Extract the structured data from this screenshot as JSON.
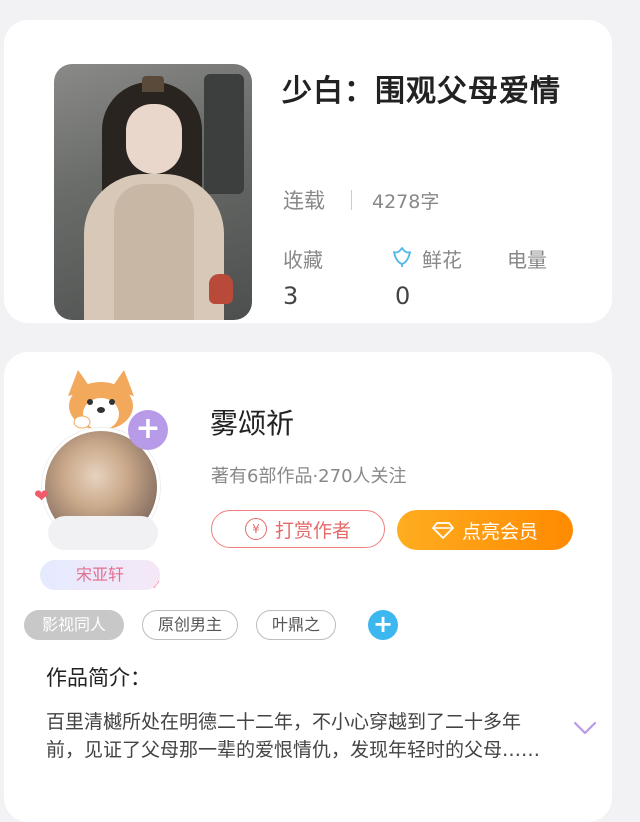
{
  "book": {
    "title": "少白：围观父母爱情",
    "status": "连载",
    "word_count": "4278字",
    "stats": [
      {
        "label": "收藏",
        "value": "3"
      },
      {
        "label": "鲜花",
        "value": "0",
        "icon": "flower-icon"
      },
      {
        "label": "电量",
        "value": ""
      }
    ]
  },
  "author": {
    "name": "雾颂祈",
    "meta": "著有6部作品·270人关注",
    "name_tag": "宋亚轩",
    "tip_button": "打赏作者",
    "vip_button": "点亮会员"
  },
  "tags": [
    {
      "label": "影视同人",
      "style": "filled"
    },
    {
      "label": "原创男主",
      "style": "outline"
    },
    {
      "label": "叶鼎之",
      "style": "outline"
    }
  ],
  "intro": {
    "heading": "作品简介：",
    "text": "百里清樾所处在明德二十二年，不小心穿越到了二十多年前，见证了父母那一辈的爱恨情仇，发现年轻时的父母……"
  },
  "colors": {
    "accent_orange": "#ff9a10",
    "tip_red": "#e56b6b",
    "add_blue": "#3cb7f0",
    "badge_purple": "#b79ae8"
  }
}
